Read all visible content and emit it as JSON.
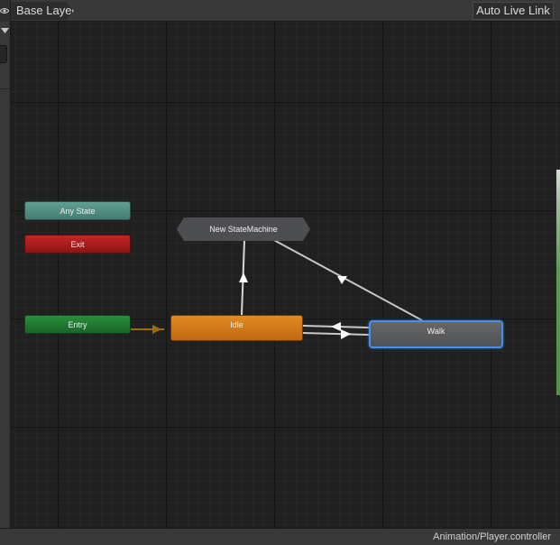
{
  "toolbar": {
    "breadcrumb": "Base Layer",
    "live_link_label": "Auto Live Link",
    "visibility_icon": "eye-icon"
  },
  "left_panel": {
    "dropdown_icon": "triangle-down-icon"
  },
  "graph": {
    "states": {
      "any_state": {
        "label": "Any State",
        "color": "#4f8b7e"
      },
      "exit": {
        "label": "Exit",
        "color": "#a61b1b"
      },
      "entry": {
        "label": "Entry",
        "color": "#207a31"
      },
      "idle": {
        "label": "Idle",
        "color": "#d17818"
      },
      "walk": {
        "label": "Walk",
        "color": "#5a5c5e",
        "selected": true
      },
      "new_state_machine": {
        "label": "New StateMachine",
        "color": "#4c4e51"
      }
    },
    "transitions": [
      {
        "from": "Entry",
        "to": "Idle",
        "color": "#a06a10"
      },
      {
        "from": "Idle",
        "to": "New StateMachine"
      },
      {
        "from": "Walk",
        "to": "New StateMachine"
      },
      {
        "from": "Idle",
        "to": "Walk"
      },
      {
        "from": "Walk",
        "to": "Idle"
      }
    ],
    "accent_color": "#4b8fe0"
  },
  "status": {
    "path": "Animation/Player.controller"
  }
}
